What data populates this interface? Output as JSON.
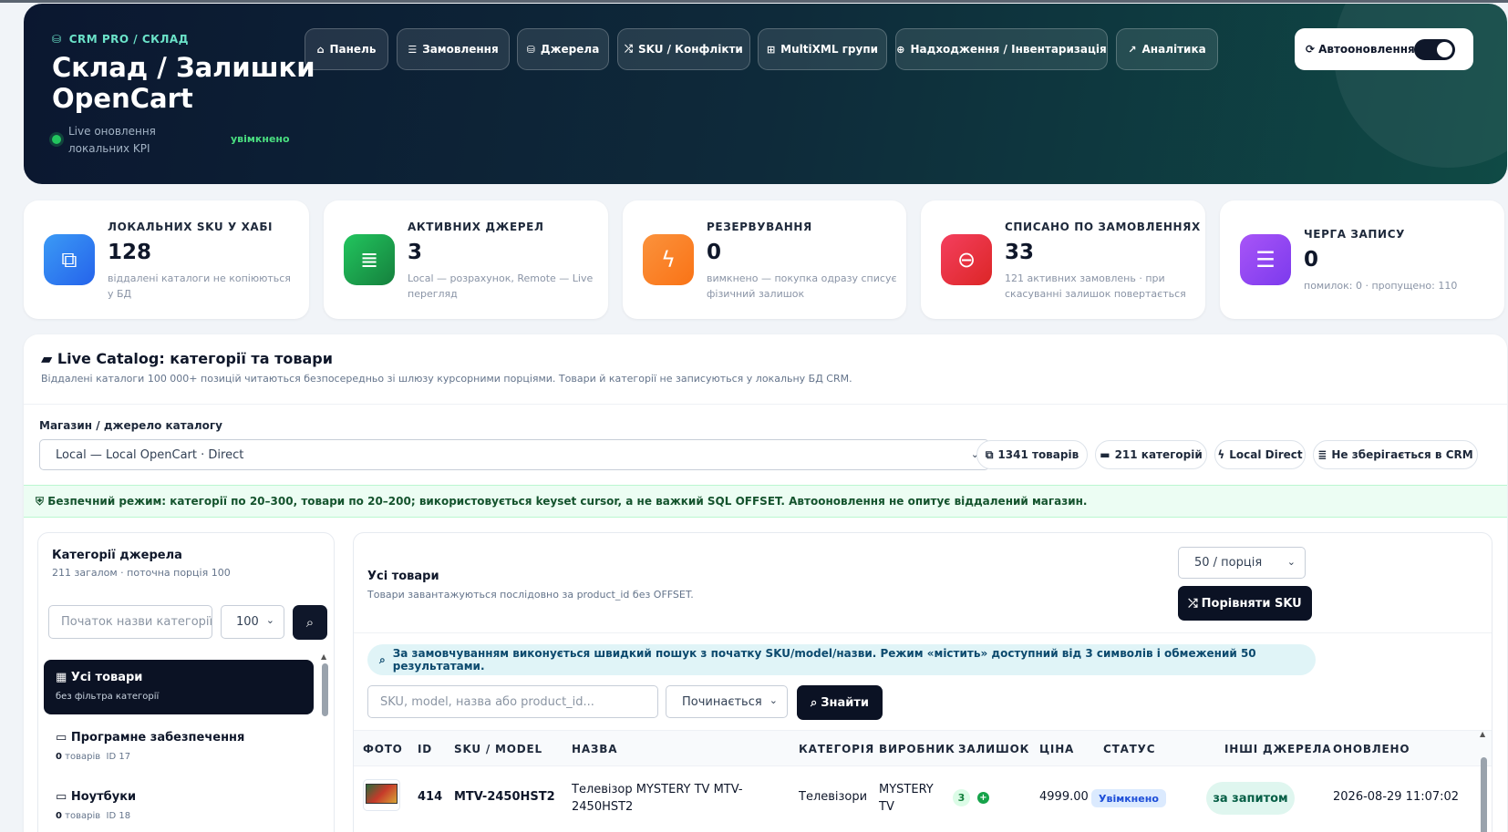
{
  "header": {
    "brand": "CRM PRO / СКЛАД",
    "title": "Склад / Залишки OpenCart",
    "live_text": "Live оновлення локальних KPI",
    "live_status": "увімкнено",
    "nav": [
      {
        "label": "Панель",
        "icon": "home-icon"
      },
      {
        "label": "Замовлення",
        "icon": "list-icon"
      },
      {
        "label": "Джерела",
        "icon": "database-icon"
      },
      {
        "label": "SKU / Конфлікти",
        "icon": "shuffle-icon"
      },
      {
        "label": "MultiXML групи",
        "icon": "sitemap-icon"
      },
      {
        "label": "Надходження / Інвентаризація",
        "icon": "plus-circle-icon"
      },
      {
        "label": "Аналітика",
        "icon": "chart-icon"
      }
    ],
    "auto_refresh": {
      "label": "Автооновлення",
      "enabled": true
    }
  },
  "kpis": [
    {
      "label": "ЛОКАЛЬНИХ SKU У ХАБІ",
      "value": "128",
      "sub": "віддалені каталоги не копіюються у БД",
      "color": "#2f80ed",
      "icon": "cubes-icon"
    },
    {
      "label": "АКТИВНИХ ДЖЕРЕЛ",
      "value": "3",
      "sub": "Local — розрахунок, Remote — Live перегляд",
      "color": "#16a34a",
      "icon": "database-icon"
    },
    {
      "label": "РЕЗЕРВУВАННЯ",
      "value": "0",
      "sub": "вимкнено — покупка одразу списує фізичний залишок",
      "color": "#f97316",
      "icon": "bolt-icon"
    },
    {
      "label": "СПИСАНО ПО ЗАМОВЛЕННЯХ",
      "value": "33",
      "sub": "121 активних замовлень · при скасуванні залишок повертається",
      "color": "#e11d48",
      "icon": "minus-circle-icon"
    },
    {
      "label": "ЧЕРГА ЗАПИСУ",
      "value": "0",
      "sub": "помилок: 0 · пропущено: 110",
      "color": "#9333ea",
      "icon": "server-icon"
    }
  ],
  "catalog": {
    "title": "Live Catalog: категорії та товари",
    "subtitle": "Віддалені каталоги 100 000+ позицій читаються безпосередньо зі шлюзу курсорними порціями. Товари й категорії не записуються у локальну БД CRM.",
    "source_label": "Магазин / джерело каталогу",
    "source_value": "Local — Local OpenCart · Direct",
    "pills": [
      {
        "label": "1341 товарів",
        "icon": "cubes-icon"
      },
      {
        "label": "211 категорій",
        "icon": "folder-icon"
      },
      {
        "label": "Local Direct",
        "icon": "bolt-icon"
      },
      {
        "label": "Не зберігається в CRM",
        "icon": "database-icon"
      }
    ],
    "safe_mode": "Безпечний режим: категорії по 20–300, товари по 20–200; використовується keyset cursor, а не важкий SQL OFFSET. Автооновлення не опитує віддалений магазин."
  },
  "categories": {
    "title": "Категорії джерела",
    "subtitle": "211 загалом · поточна порція 100",
    "search_placeholder": "Початок назви категорії",
    "limit": "100",
    "items": [
      {
        "name": "Усі товари",
        "meta": "без фільтра категорії",
        "active": true
      },
      {
        "name": "Програмне забезпечення",
        "count": "0",
        "count_label": "товарів",
        "id": "ID 17"
      },
      {
        "name": "Ноутбуки",
        "count": "0",
        "count_label": "товарів",
        "id": "ID 18"
      }
    ]
  },
  "products": {
    "title": "Усі товари",
    "subtitle": "Товари завантажуються послідовно за product_id без OFFSET.",
    "batch": "50 / порція",
    "compare_label": "Порівняти SKU",
    "info": "За замовчуванням виконується швидкий пошук з початку SKU/model/назви. Режим «містить» доступний від 3 символів і обмежений 50 результатами.",
    "search_placeholder": "SKU, model, назва або product_id...",
    "mode": "Починається",
    "find_label": "Знайти",
    "columns": [
      "ФОТО",
      "ID",
      "SKU / MODEL",
      "НАЗВА",
      "КАТЕГОРІЯ",
      "ВИРОБНИК",
      "ЗАЛИШОК",
      "ЦІНА",
      "СТАТУС",
      "ІНШІ ДЖЕРЕЛА",
      "ОНОВЛЕНО"
    ],
    "rows": [
      {
        "id": "414",
        "sku": "MTV-2450HST2",
        "name": "Телевізор MYSTERY TV MTV-2450HST2",
        "category": "Телевізори",
        "maker": "MYSTERY TV",
        "stock": "3",
        "price": "4999.00",
        "status": "Увімкнено",
        "other": "за запитом",
        "updated": "2026-08-29 11:07:02"
      }
    ]
  }
}
